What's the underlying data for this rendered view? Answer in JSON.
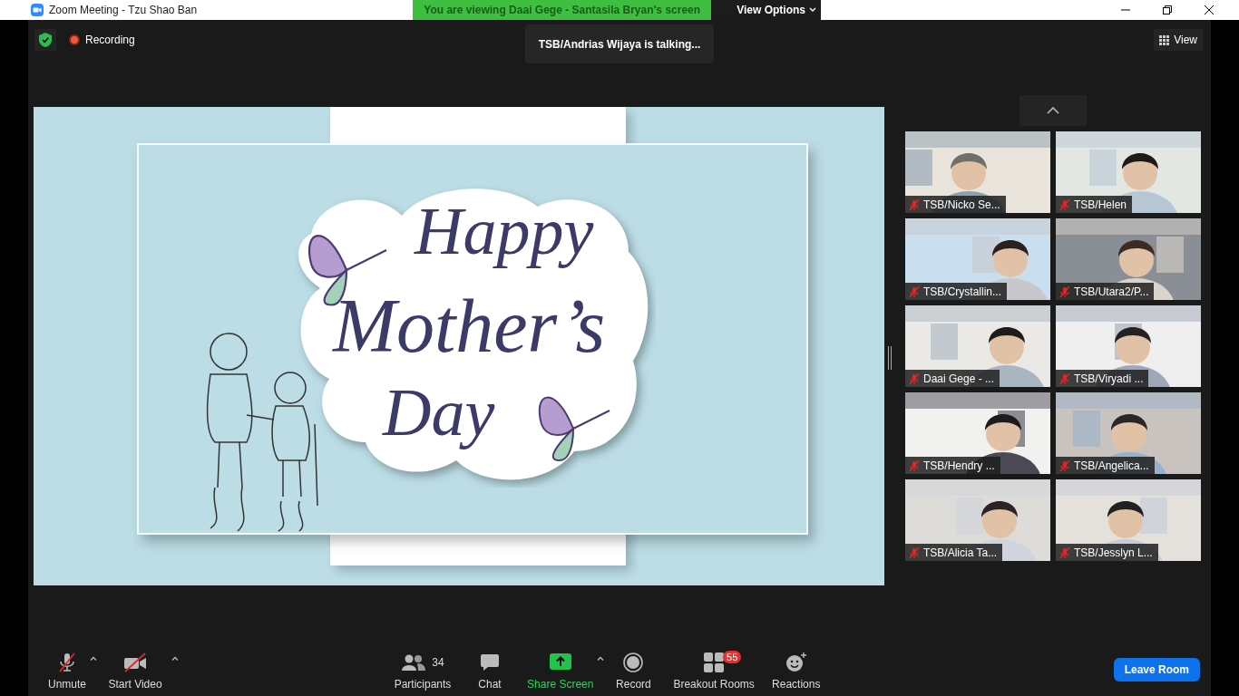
{
  "window": {
    "title": "Zoom Meeting - Tzu Shao Ban"
  },
  "banner": {
    "text": "You are viewing Daai Gege - Santasila Bryan's screen",
    "menu": "View Options"
  },
  "top_bar": {
    "recording": "Recording",
    "talking": "TSB/Andrias Wijaya is talking...",
    "view": "View"
  },
  "shared_screen": {
    "lines": [
      "Happy",
      "Mother’s",
      "Day"
    ]
  },
  "participants": [
    {
      "name": "TSB/Nicko Se...",
      "muted": true
    },
    {
      "name": "TSB/Helen",
      "muted": true
    },
    {
      "name": "TSB/Crystallin...",
      "muted": true
    },
    {
      "name": "TSB/Utara2/P...",
      "muted": true
    },
    {
      "name": "Daai Gege - ...",
      "muted": true
    },
    {
      "name": "TSB/Viryadi ...",
      "muted": true
    },
    {
      "name": "TSB/Hendry ...",
      "muted": true
    },
    {
      "name": "TSB/Angelica...",
      "muted": true
    },
    {
      "name": "TSB/Alicia Ta...",
      "muted": true
    },
    {
      "name": "TSB/Jesslyn L...",
      "muted": true
    }
  ],
  "toolbar": [
    {
      "kind": "mic",
      "label": "Unmute",
      "off": true,
      "caret": true
    },
    {
      "kind": "video",
      "label": "Start Video",
      "off": true,
      "caret": true
    },
    {
      "kind": "participants",
      "label": "Participants",
      "count": "34",
      "caret": false
    },
    {
      "kind": "chat",
      "label": "Chat",
      "caret": false
    },
    {
      "kind": "share",
      "label": "Share Screen",
      "caret": true
    },
    {
      "kind": "record",
      "label": "Record",
      "caret": false
    },
    {
      "kind": "breakout",
      "label": "Breakout Rooms",
      "badge": "55",
      "caret": false
    },
    {
      "kind": "reactions",
      "label": "Reactions",
      "caret": false
    }
  ],
  "leave": "Leave Room"
}
